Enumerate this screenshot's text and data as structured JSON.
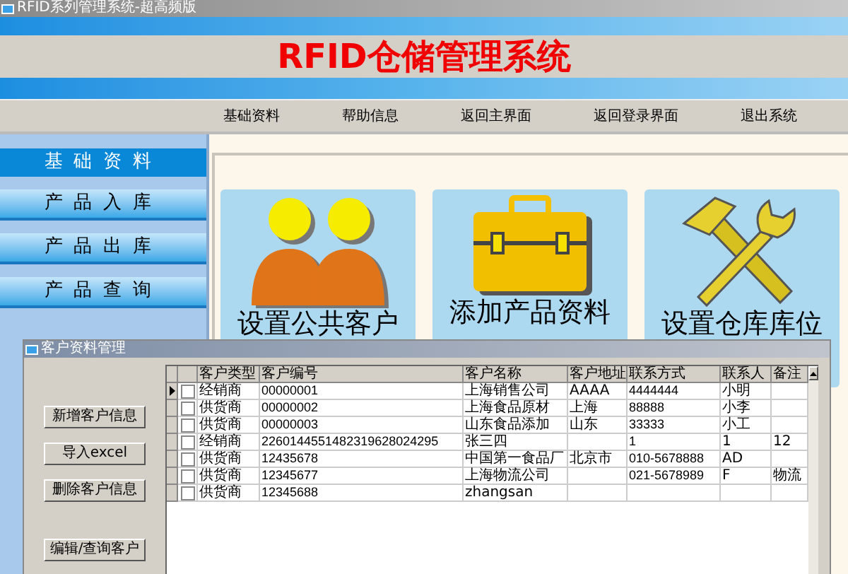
{
  "window": {
    "title": "RFID系列管理系统-超高频版"
  },
  "banner": {
    "title": "RFID仓储管理系统"
  },
  "nav": [
    "基础资料",
    "帮助信息",
    "返回主界面",
    "返回登录界面",
    "退出系统"
  ],
  "sidebar": {
    "items": [
      {
        "label": "基础资料",
        "selected": true
      },
      {
        "label": "产品入库",
        "selected": false
      },
      {
        "label": "产品出库",
        "selected": false
      },
      {
        "label": "产品查询",
        "selected": false
      }
    ]
  },
  "cards": [
    {
      "kind": "people",
      "label": "设置公共客户"
    },
    {
      "kind": "briefcase",
      "label": "添加产品资料"
    },
    {
      "kind": "tools",
      "label": "设置仓库库位"
    }
  ],
  "dialog": {
    "title": "客户资料管理",
    "buttons": [
      "新增客户信息",
      "导入excel",
      "删除客户信息",
      "编辑/查询客户"
    ],
    "table": {
      "columns": [
        "客户类型",
        "客户编号",
        "客户名称",
        "客户地址",
        "联系方式",
        "联系人",
        "备注"
      ],
      "rows": [
        {
          "selected": true,
          "checked": false,
          "cells": [
            "经销商",
            "00000001",
            "上海销售公司",
            "AAAA",
            "4444444",
            "小明",
            ""
          ]
        },
        {
          "selected": false,
          "checked": false,
          "cells": [
            "供货商",
            "00000002",
            "上海食品原材",
            "上海",
            "88888",
            "小李",
            ""
          ]
        },
        {
          "selected": false,
          "checked": false,
          "cells": [
            "供货商",
            "00000003",
            "山东食品添加",
            "山东",
            "33333",
            "小工",
            ""
          ]
        },
        {
          "selected": false,
          "checked": false,
          "cells": [
            "经销商",
            "2260144551482319628024295",
            "张三四",
            "",
            "1",
            "1",
            "12"
          ]
        },
        {
          "selected": false,
          "checked": false,
          "cells": [
            "供货商",
            "12435678",
            "中国第一食品厂",
            "北京市",
            "010-5678888",
            "AD",
            ""
          ]
        },
        {
          "selected": false,
          "checked": false,
          "cells": [
            "供货商",
            "12345677",
            "上海物流公司",
            "",
            "021-5678989",
            "F",
            "物流"
          ]
        },
        {
          "selected": false,
          "checked": false,
          "cells": [
            "供货商",
            "12345688",
            "zhangsan",
            "",
            "",
            "",
            ""
          ]
        }
      ]
    }
  }
}
